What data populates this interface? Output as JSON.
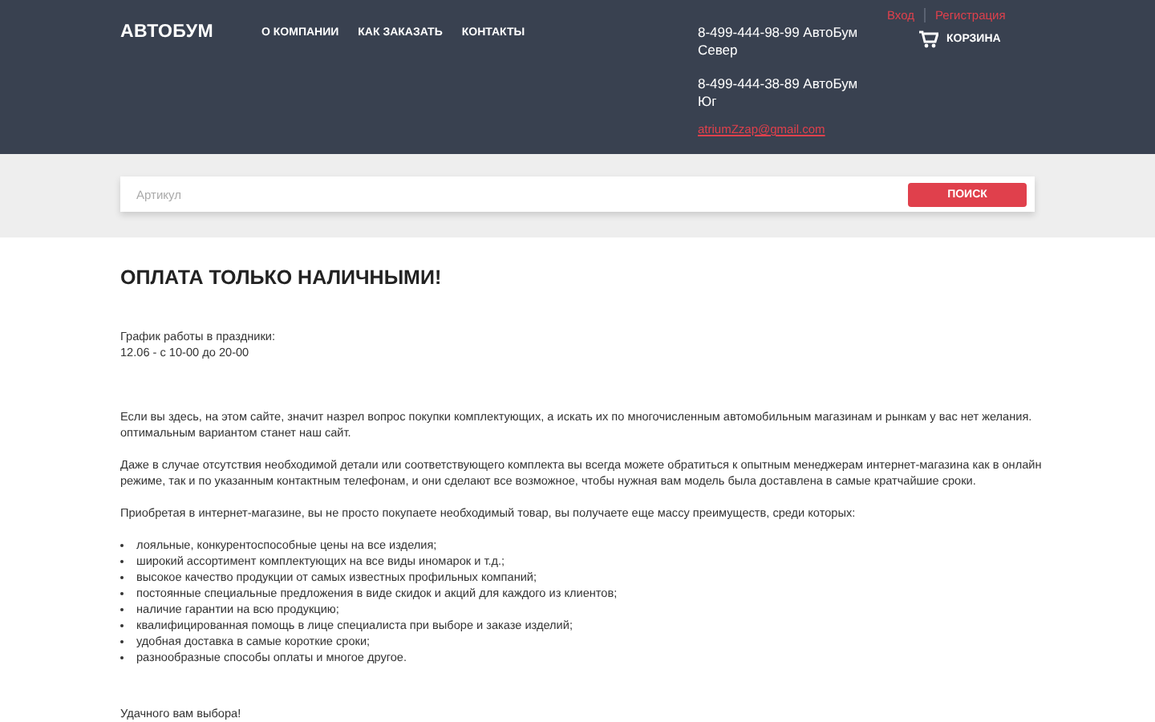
{
  "header": {
    "logo": "АВТОБУМ",
    "nav": [
      "О КОМПАНИИ",
      "КАК ЗАКАЗАТЬ",
      "КОНТАКТЫ"
    ],
    "phones": [
      "8-499-444-98-99 АвтоБум Север",
      "8-499-444-38-89 АвтоБум Юг"
    ],
    "email": "atriumZzap@gmail.com",
    "login": "Вход",
    "register": "Регистрация",
    "cart": "КОРЗИНА"
  },
  "search": {
    "placeholder": "Артикул",
    "button": "ПОИСК"
  },
  "content": {
    "title": "ОПЛАТА ТОЛЬКО НАЛИЧНЫМИ!",
    "schedule": [
      "График работы в праздники:",
      "12.06 - с 10-00 до 20-00"
    ],
    "paragraphs": [
      "Если вы здесь, на этом сайте, значит назрел вопрос покупки комплектующих, а искать их по многочисленным автомобильным магазинам и рынкам у вас нет желания. оптимальным вариантом станет наш сайт.",
      "Даже в случае отсутствия необходимой детали или соответствующего комплекта вы всегда можете обратиться к опытным менеджерам интернет-магазина как в онлайн режиме, так и по указанным контактным телефонам, и они сделают все возможное, чтобы нужная вам модель была доставлена в самые кратчайшие сроки.",
      "Приобретая в интернет-магазине, вы не просто покупаете необходимый товар, вы получаете еще массу преимуществ, среди которых:"
    ],
    "list": [
      "лояльные, конкурентоспособные цены на все изделия;",
      "широкий ассортимент комплектующих на все виды иномарок и т.д.;",
      "высокое качество продукции от самых известных профильных компаний;",
      "постоянные специальные предложения в виде скидок и акций для каждого из клиентов;",
      "наличие гарантии на всю продукцию;",
      "квалифицированная помощь в лице специалиста при выборе и заказе изделий;",
      "удобная доставка в самые короткие сроки;",
      "разнообразные способы оплаты и многое другое."
    ],
    "closing": "Удачного вам выбора!"
  }
}
